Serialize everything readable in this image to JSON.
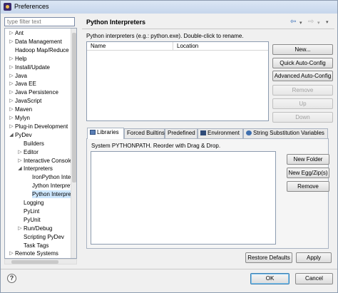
{
  "window": {
    "title": "Preferences"
  },
  "sidebar": {
    "filter_placeholder": "type filter text",
    "tree": [
      {
        "label": "Ant",
        "arrow": "▷"
      },
      {
        "label": "Data Management",
        "arrow": "▷"
      },
      {
        "label": "Hadoop Map/Reduce",
        "arrow": ""
      },
      {
        "label": "Help",
        "arrow": "▷"
      },
      {
        "label": "Install/Update",
        "arrow": "▷"
      },
      {
        "label": "Java",
        "arrow": "▷"
      },
      {
        "label": "Java EE",
        "arrow": "▷"
      },
      {
        "label": "Java Persistence",
        "arrow": "▷"
      },
      {
        "label": "JavaScript",
        "arrow": "▷"
      },
      {
        "label": "Maven",
        "arrow": "▷"
      },
      {
        "label": "Mylyn",
        "arrow": "▷"
      },
      {
        "label": "Plug-in Development",
        "arrow": "▷"
      },
      {
        "label": "PyDev",
        "arrow": "◢"
      },
      {
        "label": "Builders",
        "arrow": ""
      },
      {
        "label": "Editor",
        "arrow": "▷"
      },
      {
        "label": "Interactive Console",
        "arrow": "▷"
      },
      {
        "label": "Interpreters",
        "arrow": "◢"
      },
      {
        "label": "IronPython Interpreter",
        "arrow": ""
      },
      {
        "label": "Jython Interpreter",
        "arrow": ""
      },
      {
        "label": "Python Interpreter",
        "arrow": ""
      },
      {
        "label": "Logging",
        "arrow": ""
      },
      {
        "label": "PyLint",
        "arrow": ""
      },
      {
        "label": "PyUnit",
        "arrow": ""
      },
      {
        "label": "Run/Debug",
        "arrow": "▷"
      },
      {
        "label": "Scripting PyDev",
        "arrow": ""
      },
      {
        "label": "Task Tags",
        "arrow": ""
      },
      {
        "label": "Remote Systems",
        "arrow": "▷"
      }
    ]
  },
  "page": {
    "title": "Python Interpreters",
    "description": "Python interpreters (e.g.: python.exe).   Double-click to rename.",
    "nav": {
      "back_icon": "back-arrow-icon",
      "forward_icon": "forward-arrow-icon"
    },
    "table": {
      "columns": [
        "Name",
        "Location"
      ]
    },
    "buttons": {
      "new": "New...",
      "quick_auto_config": "Quick Auto-Config",
      "advanced_auto_config": "Advanced Auto-Config",
      "remove": "Remove",
      "up": "Up",
      "down": "Down"
    },
    "tabs": [
      {
        "label": "Libraries",
        "icon": "libraries-icon"
      },
      {
        "label": "Forced Builtins",
        "icon": ""
      },
      {
        "label": "Predefined",
        "icon": ""
      },
      {
        "label": "Environment",
        "icon": "environment-icon"
      },
      {
        "label": "String Substitution Variables",
        "icon": "variables-icon"
      }
    ],
    "libraries": {
      "description": "System PYTHONPATH.   Reorder with Drag & Drop.",
      "buttons": {
        "new_folder": "New Folder",
        "new_egg_zip": "New Egg/Zip(s)",
        "remove": "Remove"
      }
    },
    "restore_defaults": "Restore Defaults",
    "apply": "Apply"
  },
  "footer": {
    "help": "?",
    "ok": "OK",
    "cancel": "Cancel"
  },
  "colors": {
    "accent": "#3a6fb8",
    "selection": "#cfe8ff"
  }
}
